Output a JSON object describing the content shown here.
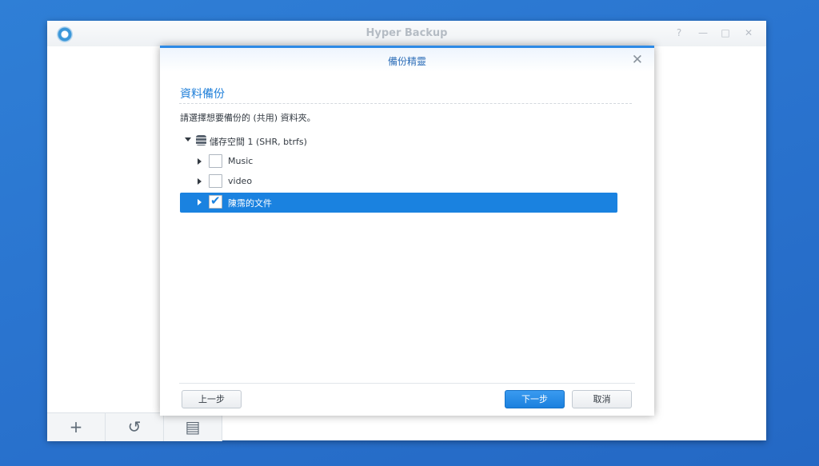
{
  "app": {
    "title": "Hyper Backup",
    "controls": {
      "help": "?",
      "minimize": "—",
      "maximize": "□",
      "close": "✕"
    },
    "toolbar": [
      {
        "icon": "plus-icon",
        "glyph": "+"
      },
      {
        "icon": "history-icon",
        "glyph": "↺"
      },
      {
        "icon": "log-icon",
        "glyph": "▤"
      }
    ]
  },
  "wizard": {
    "title": "備份精靈",
    "close_glyph": "✕",
    "section_title": "資料備份",
    "instruction": "請選擇想要備份的 (共用) 資料夾。",
    "tree": {
      "volume": "儲存空間 1 (SHR, btrfs)",
      "folders": [
        {
          "label": "Music",
          "checked": false,
          "selected": false
        },
        {
          "label": "video",
          "checked": false,
          "selected": false
        },
        {
          "label": "陳霈的文件",
          "checked": true,
          "selected": true
        }
      ]
    },
    "buttons": {
      "back": "上一步",
      "next": "下一步",
      "cancel": "取消"
    }
  },
  "colors": {
    "accent": "#1a82e0",
    "desktop": "#2a74cf"
  }
}
